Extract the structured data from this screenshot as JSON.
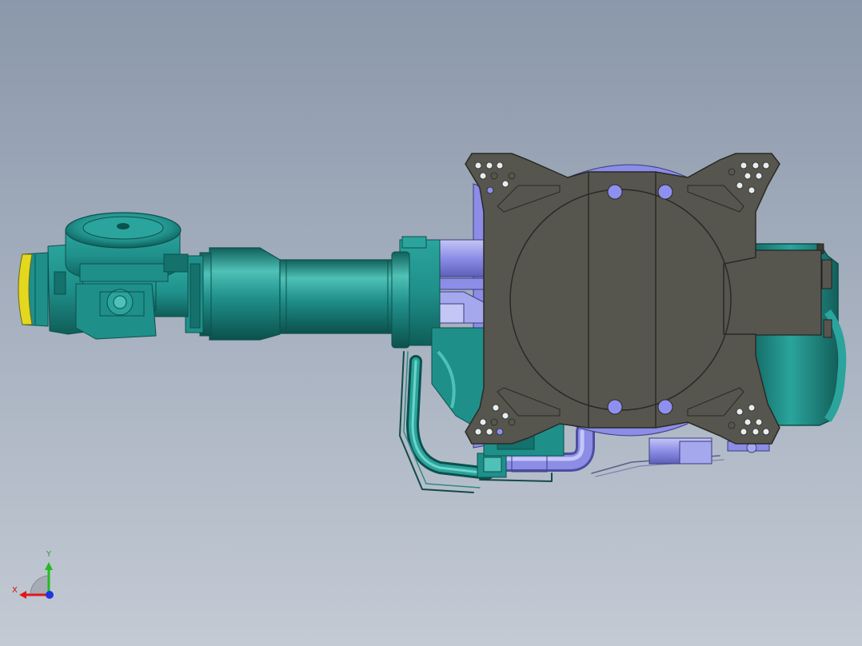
{
  "viewport": {
    "background_top": "#8b98ab",
    "background_bottom": "#c3cad4"
  },
  "model": {
    "colors": {
      "body_teal": "#1f8f8a",
      "body_teal_light": "#4fc1b6",
      "body_teal_dark": "#10605c",
      "base_plate": "#56564f",
      "base_plate_edge": "#2a2a26",
      "bracket_lavender": "#8c8de6",
      "bracket_lavender_light": "#c4c6f5",
      "flange_yellow": "#e3d81f",
      "hole_lavender": "#8f8ff0",
      "hole_white": "#e6ecef"
    }
  },
  "triad": {
    "x_label": "X",
    "y_label": "Y",
    "x_color": "#e0191b",
    "y_color": "#22bb22",
    "z_color": "#2233dd",
    "x_label_color": "#cc1111",
    "y_label_color": "#22aa22"
  }
}
